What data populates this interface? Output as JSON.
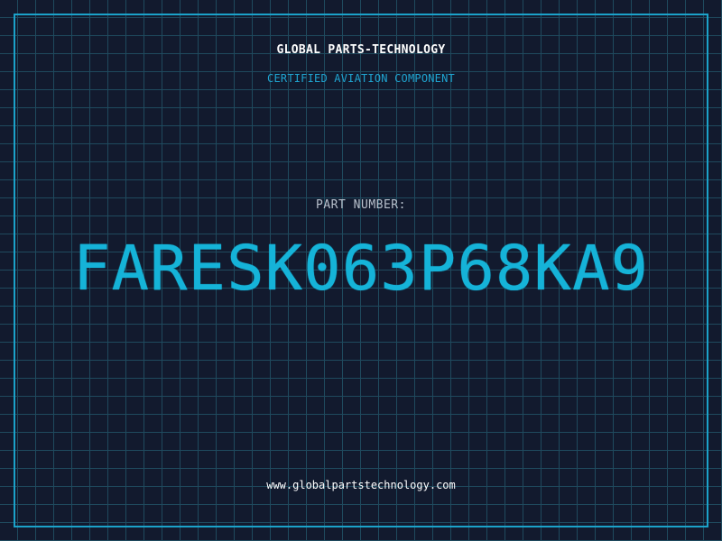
{
  "header": {
    "company": "GLOBAL PARTS-TECHNOLOGY",
    "subtitle": "CERTIFIED AVIATION COMPONENT"
  },
  "part": {
    "label": "PART NUMBER:",
    "number": "FARESK063P68KA9"
  },
  "footer": {
    "website": "www.globalpartstechnology.com"
  },
  "colors": {
    "background": "#121a2e",
    "grid": "#1f4a5e",
    "accent": "#15b3d8",
    "frame": "#1ba2c9"
  }
}
